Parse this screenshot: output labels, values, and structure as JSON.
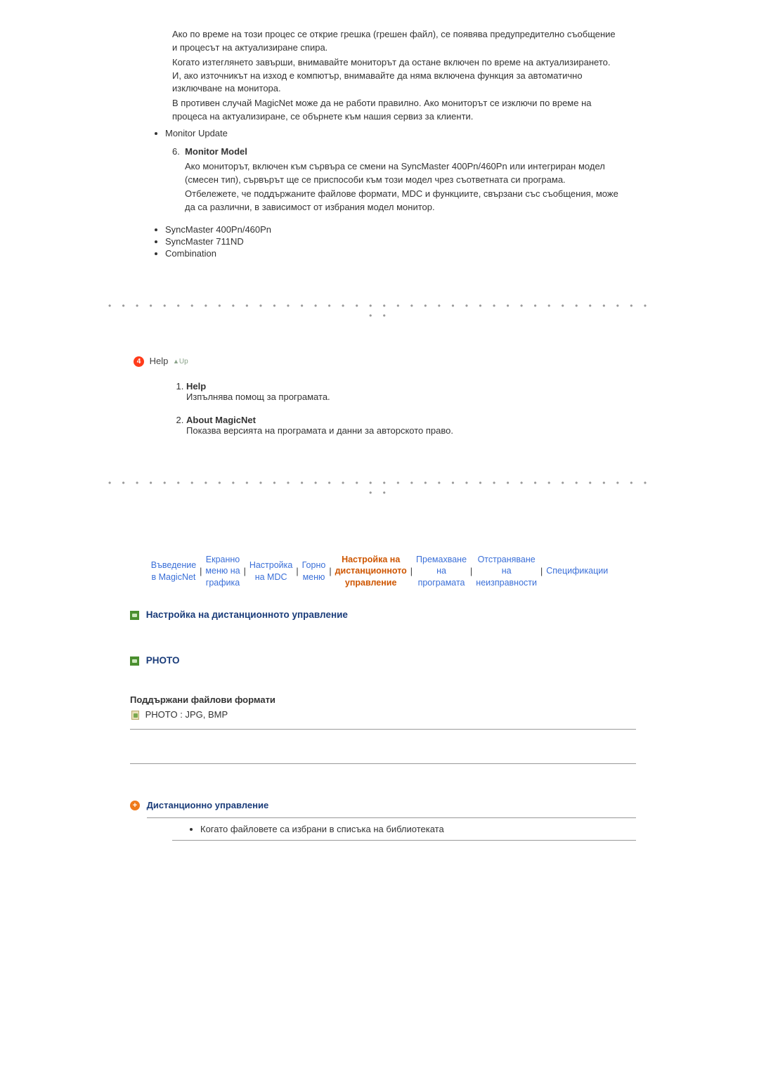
{
  "body": {
    "para1": "Ако по време на този процес се открие грешка (грешен файл), се появява предупредително съобщение и процесът на актуализиране спира.",
    "para2": "Когато изтеглянето завърши, внимавайте мониторът да остане включен по време на актуализирането. И, ако източникът на изход е компютър, внимавайте да няма включена функция за автоматично изключване на монитора.",
    "para3": "В противен случай MagicNet може да не работи правилно. Ако мониторът се изключи по време на процеса на актуализиране, се обърнете към нашия сервиз за клиенти.",
    "monitor_update": "Monitor Update",
    "item6_num": "6.",
    "item6_title": "Monitor Model",
    "item6_p1": "Ако мониторът, включен към сървъра се смени на SyncMaster 400Pn/460Pn или интегриран модел (смесен тип), сървърът ще се приспособи към този модел чрез съответната си програма.",
    "item6_p2": "Отбележете, че поддържаните файлове формати, MDC и функциите, свързани със съобщения, може да са различни, в зависимост от избрания модел монитор.",
    "models": [
      "SyncMaster 400Pn/460Pn",
      "SyncMaster 711ND",
      "Combination"
    ]
  },
  "help": {
    "badge": "4",
    "title": "Help",
    "up": "Up",
    "items": [
      {
        "title": "Help",
        "desc": "Изпълнява помощ за програмата."
      },
      {
        "title": "About MagicNet",
        "desc": "Показва версията на програмата и данни за авторското право."
      }
    ]
  },
  "nav": {
    "c0a": "Въведение",
    "c0b": "в MagicNet",
    "c1a": "Екранно",
    "c1b": "меню на",
    "c1c": "графика",
    "c2a": "Настройка",
    "c2b": "на MDC",
    "c3a": "Горно",
    "c3b": "меню",
    "c4a": "Настройка на",
    "c4b": "дистанционното",
    "c4c": "управление",
    "c5a": "Премахване",
    "c5b": "на",
    "c5c": "програмата",
    "c6a": "Отстраняване",
    "c6b": "на",
    "c6c": "неизправности",
    "c7": "Спецификации"
  },
  "remote": {
    "title": "Настройка на дистанционното управление",
    "photo_title": "PHOTO",
    "formats_title": "Поддържани файлови формати",
    "formats_line": "PHOTO : JPG, BMP",
    "remote_control": "Дистанционно управление",
    "bullet1": "Когато файловете са избрани в списъка на библиотеката"
  }
}
